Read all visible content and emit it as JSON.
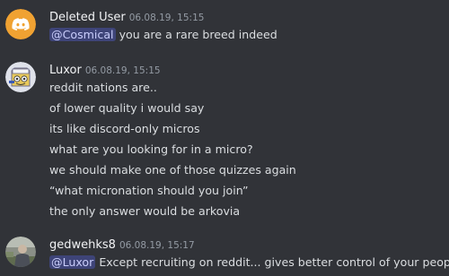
{
  "messages": [
    {
      "username": "Deleted User",
      "timestamp": "06.08.19, 15:15",
      "avatar_icon": "discord-logo-icon",
      "avatar_color": "#f0a232",
      "lines": [
        {
          "mention": "@Cosmical",
          "text": " you are a rare breed indeed"
        }
      ]
    },
    {
      "username": "Luxor",
      "timestamp": "06.08.19, 15:15",
      "avatar_icon": "luxor-avatar-icon",
      "lines": [
        {
          "text": "reddit nations are.."
        },
        {
          "text": "of lower quality i would say"
        },
        {
          "text": "its like discord-only micros"
        },
        {
          "text": "what are you looking for in a micro?"
        },
        {
          "text": "we should make one of those quizzes again"
        },
        {
          "text": "“what micronation should you join”"
        },
        {
          "text": "the only answer would be arkovia"
        }
      ]
    },
    {
      "username": "gedwehks8",
      "timestamp": "06.08.19, 15:17",
      "avatar_icon": "user-photo-avatar-icon",
      "lines": [
        {
          "mention": "@Luxor",
          "text": " Except recruiting on reddit... gives better control of your people"
        }
      ]
    }
  ],
  "colors": {
    "background": "#313338",
    "username": "#f2f3f5",
    "timestamp": "#949ba4",
    "message_text": "#dbdee1",
    "mention_bg": "#3c4270",
    "mention_text": "#c9cdfb"
  }
}
